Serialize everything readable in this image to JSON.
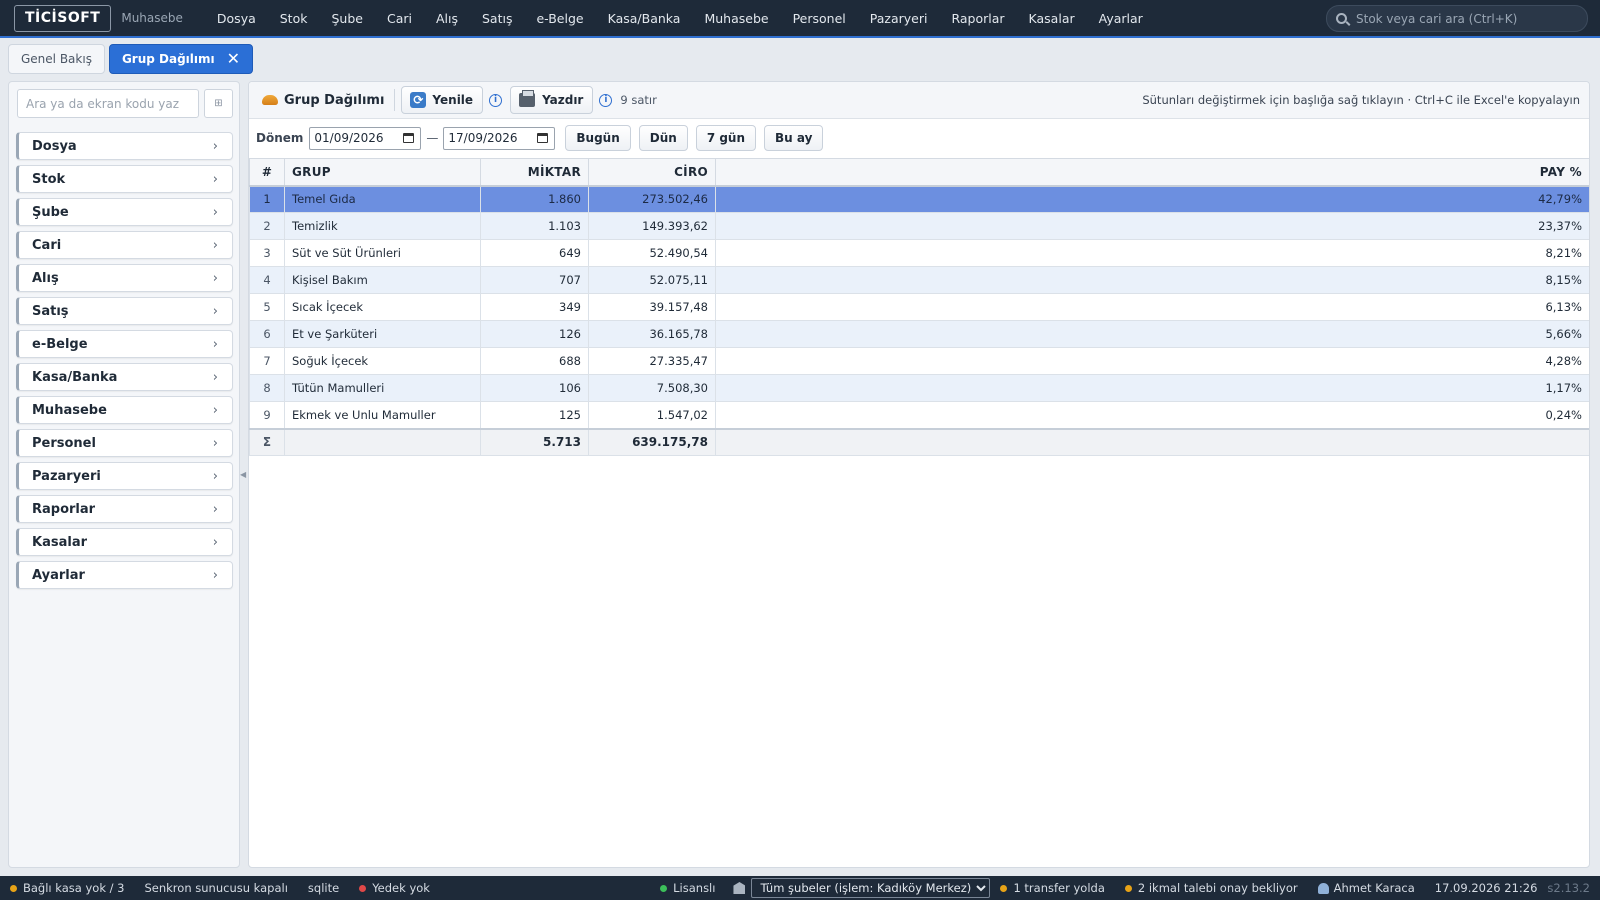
{
  "app": {
    "logo": "TİCİSOFT",
    "module": "Muhasebe"
  },
  "menu": [
    "Dosya",
    "Stok",
    "Şube",
    "Cari",
    "Alış",
    "Satış",
    "e-Belge",
    "Kasa/Banka",
    "Muhasebe",
    "Personel",
    "Pazaryeri",
    "Raporlar",
    "Kasalar",
    "Ayarlar"
  ],
  "search": {
    "placeholder": "Stok veya cari ara (Ctrl+K)"
  },
  "tabs": {
    "overview": "Genel Bakış",
    "active": "Grup Dağılımı",
    "close_glyph": "✕"
  },
  "sidebar": {
    "search_placeholder": "Ara ya da ekran kodu yaz",
    "grid_glyph": "⊞",
    "items": [
      "Dosya",
      "Stok",
      "Şube",
      "Cari",
      "Alış",
      "Satış",
      "e-Belge",
      "Kasa/Banka",
      "Muhasebe",
      "Personel",
      "Pazaryeri",
      "Raporlar",
      "Kasalar",
      "Ayarlar"
    ],
    "chevron": "›",
    "collapse_glyph": "◀"
  },
  "toolbar": {
    "title": "Grup Dağılımı",
    "refresh": "Yenile",
    "print": "Yazdır",
    "info_glyph": "i",
    "row_count": "9 satır",
    "hint": "Sütunları değiştirmek için başlığa sağ tıklayın · Ctrl+C ile Excel'e kopyalayın"
  },
  "filter": {
    "label": "Dönem",
    "from": "01/09/2026",
    "to": "17/09/2026",
    "dash": "—",
    "quick": [
      "Bugün",
      "Dün",
      "7 gün",
      "Bu ay"
    ]
  },
  "table": {
    "columns": [
      "#",
      "GRUP",
      "MİKTAR",
      "CİRO",
      "PAY %"
    ],
    "selected_row": 0,
    "rows": [
      [
        "1",
        "Temel Gıda",
        "1.860",
        "273.502,46",
        "42,79%"
      ],
      [
        "2",
        "Temizlik",
        "1.103",
        "149.393,62",
        "23,37%"
      ],
      [
        "3",
        "Süt ve Süt Ürünleri",
        "649",
        "52.490,54",
        "8,21%"
      ],
      [
        "4",
        "Kişisel Bakım",
        "707",
        "52.075,11",
        "8,15%"
      ],
      [
        "5",
        "Sıcak İçecek",
        "349",
        "39.157,48",
        "6,13%"
      ],
      [
        "6",
        "Et ve Şarküteri",
        "126",
        "36.165,78",
        "5,66%"
      ],
      [
        "7",
        "Soğuk İçecek",
        "688",
        "27.335,47",
        "4,28%"
      ],
      [
        "8",
        "Tütün Mamulleri",
        "106",
        "7.508,30",
        "1,17%"
      ],
      [
        "9",
        "Ekmek ve Unlu Mamuller",
        "125",
        "1.547,02",
        "0,24%"
      ]
    ],
    "sum": {
      "symbol": "Σ",
      "quantity": "5.713",
      "revenue": "639.175,78"
    }
  },
  "status": {
    "register": "Bağlı kasa yok / 3",
    "sync": "Senkron sunucusu kapalı",
    "db": "sqlite",
    "backup": "Yedek yok",
    "license": "Lisanslı",
    "branch": "Tüm şubeler (işlem: Kadıköy Merkez)",
    "transfer": "1 transfer yolda",
    "pending": "2 ikmal talebi onay bekliyor",
    "user": "Ahmet Karaca",
    "datetime": "17.09.2026 21:26",
    "version": "s2.13.2"
  },
  "colors": {
    "topbar": "#1e2a39",
    "accent": "#2b6fd6",
    "selected_row": "#6c8fe0",
    "status_warning": "#e8a317",
    "status_error": "#e04848",
    "status_ok": "#3cbf5a",
    "status_neutral": "#9aa6b4"
  }
}
